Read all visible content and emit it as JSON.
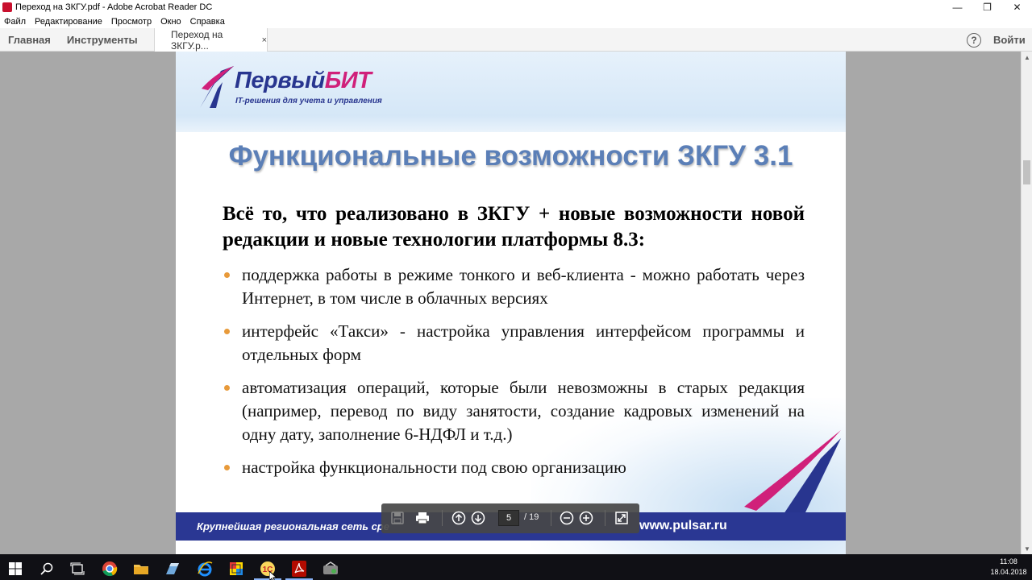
{
  "window": {
    "title": "Переход на ЗКГУ.pdf - Adobe Acrobat Reader DC",
    "controls": {
      "minimize": "—",
      "restore": "❐",
      "close": "✕"
    }
  },
  "menu": [
    "Файл",
    "Редактирование",
    "Просмотр",
    "Окно",
    "Справка"
  ],
  "tabs": {
    "home": "Главная",
    "tools": "Инструменты",
    "file": "Переход на ЗКГУ.p...",
    "file_close": "×",
    "help": "?",
    "signin": "Войти"
  },
  "slide": {
    "logo": {
      "brand_part1": "Первый",
      "brand_part2": "БИТ",
      "tagline": "IT-решения для учета и управления"
    },
    "title": "Функциональные возможности ЗКГУ 3.1",
    "lead": "Всё то, что реализовано в ЗКГУ + новые возможности новой редакции и новые технологии платформы 8.3:",
    "bullets": [
      "поддержка работы в режиме тонкого и веб-клиента  - можно работать через Интернет, в том числе в облачных версиях",
      "интерфейс «Такси» - настройка управления интерфейсом программы и отдельных форм",
      "автоматизация операций, которые были невозможны в старых редакция (например, перевод по виду занятости, создание кадровых изменений на одну дату, заполнение 6-НДФЛ и т.д.)",
      "настройка функциональности под свою организацию"
    ],
    "footer_left": "Крупнейшая региональная сеть сре",
    "footer_right": "www.pulsar.ru"
  },
  "page_nav": {
    "current": "5",
    "total": "/ 19"
  },
  "taskbar": {
    "icons": [
      "windows-start",
      "search",
      "task-view",
      "chrome",
      "file-explorer",
      "app-blue",
      "internet-explorer",
      "app-colorful",
      "1c-app",
      "acrobat-reader",
      "app-tool"
    ],
    "time": "11:08",
    "date": "18.04.2018"
  },
  "colors": {
    "brand_blue": "#28358f",
    "brand_pink": "#d0207a",
    "title_blue": "#5b7fb7",
    "bullet_orange": "#e89a3a",
    "footer_blue": "#2a3793"
  }
}
